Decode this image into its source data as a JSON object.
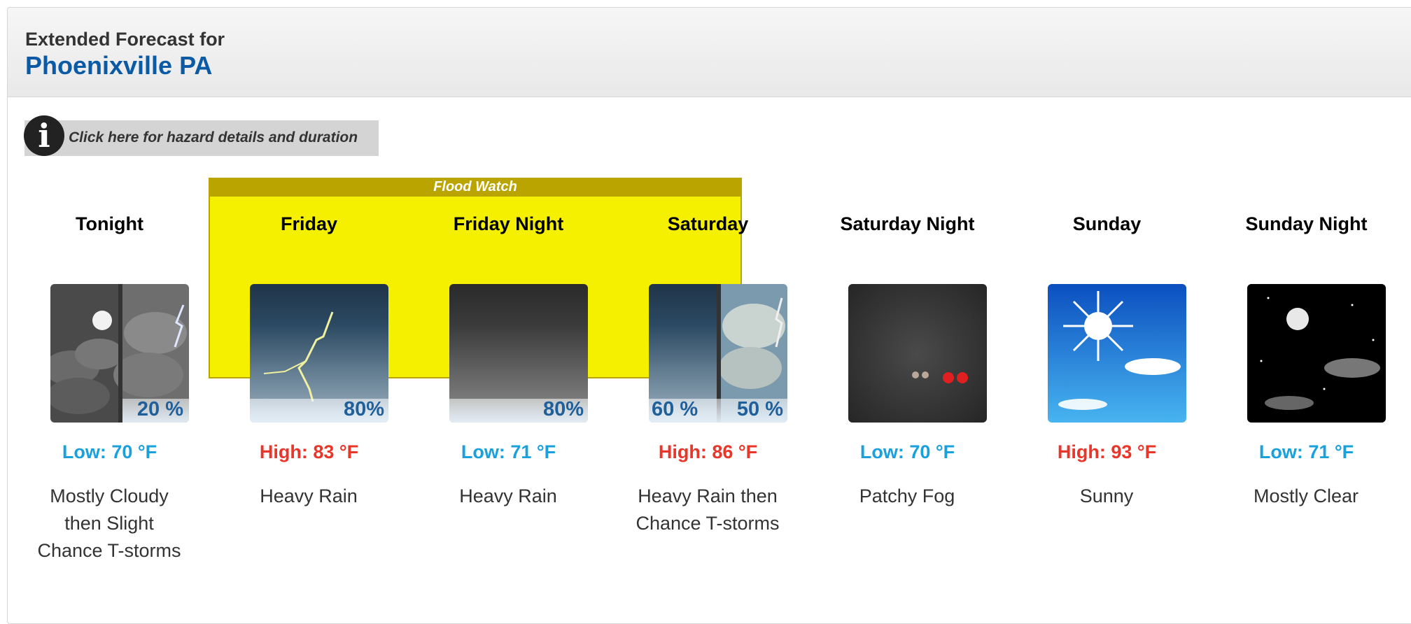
{
  "header": {
    "subtitle": "Extended Forecast for",
    "location": "Phoenixville PA"
  },
  "hazard": {
    "link_text": "Click here for hazard details and duration",
    "info_icon": "i",
    "watch_label": "Flood Watch",
    "watch_color": "#f5f000"
  },
  "periods": [
    {
      "name": "Tonight",
      "temp": "Low: 70 °F",
      "temp_type": "low",
      "desc": "Mostly Cloudy then Slight Chance T-storms",
      "icon": "night-cloudy-tstorm-icon",
      "pop": [
        "20 %"
      ]
    },
    {
      "name": "Friday",
      "temp": "High: 83 °F",
      "temp_type": "high",
      "desc": "Heavy Rain",
      "icon": "rain-lightning-icon",
      "pop": [
        "80%"
      ]
    },
    {
      "name": "Friday Night",
      "temp": "Low: 71 °F",
      "temp_type": "low",
      "desc": "Heavy Rain",
      "icon": "heavy-rain-icon",
      "pop": [
        "80%"
      ]
    },
    {
      "name": "Saturday",
      "temp": "High: 86 °F",
      "temp_type": "high",
      "desc": "Heavy Rain then Chance T-storms",
      "icon": "rain-then-tstorm-icon",
      "pop": [
        "60 %",
        "50 %"
      ]
    },
    {
      "name": "Saturday Night",
      "temp": "Low: 70 °F",
      "temp_type": "low",
      "desc": "Patchy Fog",
      "icon": "fog-icon",
      "pop": []
    },
    {
      "name": "Sunday",
      "temp": "High: 93 °F",
      "temp_type": "high",
      "desc": "Sunny",
      "icon": "sunny-icon",
      "pop": []
    },
    {
      "name": "Sunday Night",
      "temp": "Low: 71 °F",
      "temp_type": "low",
      "desc": "Mostly Clear",
      "icon": "night-clear-icon",
      "pop": []
    }
  ],
  "colors": {
    "location": "#0b5aa6",
    "low_temp": "#1aa0db",
    "high_temp": "#e8362a",
    "watch_header": "#b9a400"
  }
}
